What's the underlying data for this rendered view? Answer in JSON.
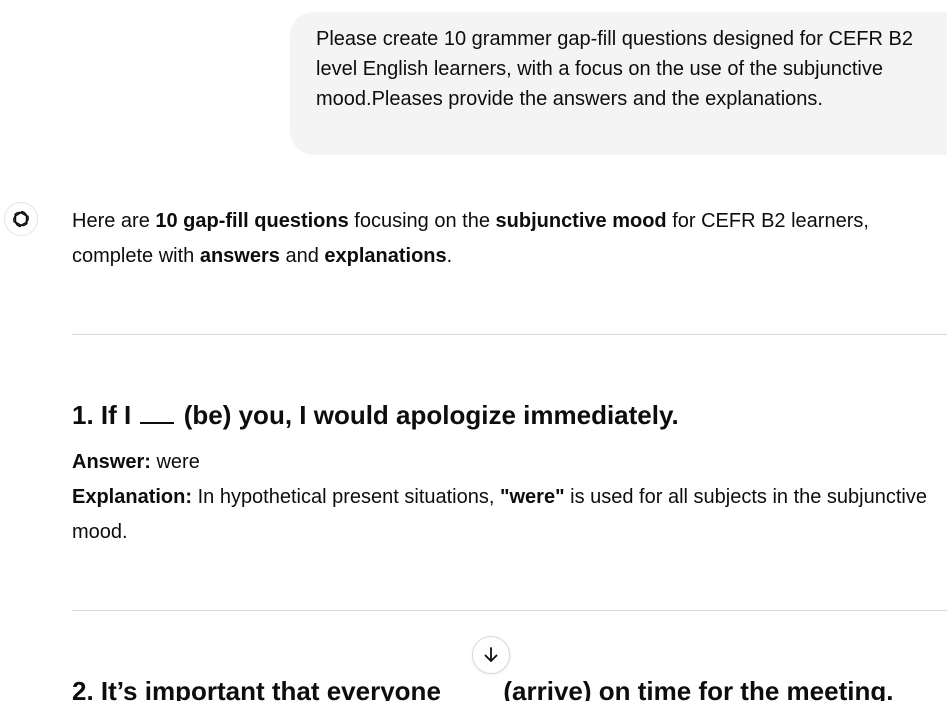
{
  "user_message": {
    "text": "Please create 10 grammer gap-fill questions designed for CEFR B2 level English learners, with a focus on the use of the subjunctive mood.Pleases provide the answers and the explanations."
  },
  "assistant": {
    "avatar_icon": "chatgpt-logo-icon",
    "intro": {
      "t1": "Here are ",
      "b1": "10 gap-fill questions",
      "t2": " focusing on the ",
      "b2": "subjunctive mood",
      "t3": " for CEFR B2 learners, complete with ",
      "b3": "answers",
      "t4": " and ",
      "b4": "explanations",
      "t5": "."
    },
    "questions": [
      {
        "prefix": "1. If I",
        "verb": "(be) you, I would apologize immediately.",
        "answer_label": "Answer:",
        "answer": "were",
        "explanation_label": "Explanation:",
        "explanation_before": "In hypothetical present situations,",
        "explanation_bold": "\"were\"",
        "explanation_after": "is used for all subjects in the subjunctive mood."
      },
      {
        "prefix": "2. It’s important that everyone",
        "verb": "(arrive) on time for the meeting."
      }
    ]
  },
  "scroll_button": {
    "icon": "arrow-down-icon"
  }
}
